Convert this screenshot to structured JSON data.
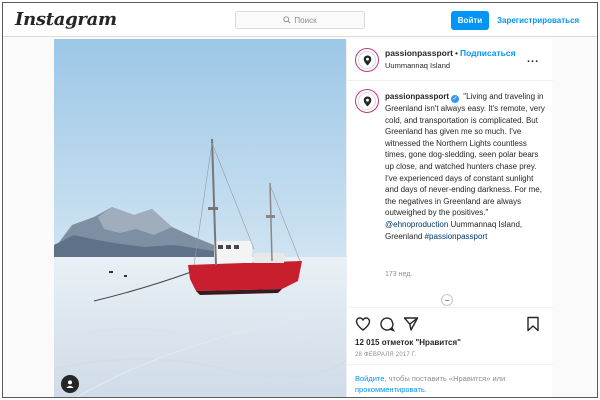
{
  "header": {
    "logo": "Instagram",
    "search_placeholder": "Поиск",
    "login_label": "Войти",
    "signup_label": "Зарегистрироваться"
  },
  "post": {
    "username": "passionpassport",
    "separator": "•",
    "follow_label": "Подписаться",
    "location": "Uummannaq Island",
    "more_label": "...",
    "caption": {
      "username": "passionpassport",
      "text": "\"Living and traveling in Greenland isn't always easy. It's remote, very cold, and transportation is complicated. But Greenland has given me so much. I've witnessed the Northern Lights countless times, gone dog-sledding, seen polar bears up close, and watched hunters chase prey. I've experienced days of constant sunlight and days of never-ending darkness. For me, the negatives in Greenland are always outweighed by the positives.\"",
      "mention": "@ehnoproduction",
      "location_text": "Uummannaq Island, Greenland",
      "hashtag": "#passionpassport",
      "time": "173 нед."
    },
    "likes": "12 015 отметок \"Нравится\"",
    "date": "28 ФЕВРАЛЯ 2017 Г.",
    "login_prompt": {
      "link1": "Войдите",
      "middle": ", чтобы поставить «Нравится» или ",
      "link2": "прокомментировать",
      "end": "."
    }
  },
  "icons": {
    "search": "search-icon",
    "heart": "heart-icon",
    "comment": "comment-icon",
    "share": "share-icon",
    "bookmark": "bookmark-icon",
    "user_tag": "user-icon",
    "verified": "verified-badge-icon",
    "location_pin": "location-pin-icon"
  },
  "colors": {
    "accent": "#0095f6",
    "link": "#00376b",
    "muted": "#8e8e8e",
    "avatar_ring": "#c13584"
  }
}
